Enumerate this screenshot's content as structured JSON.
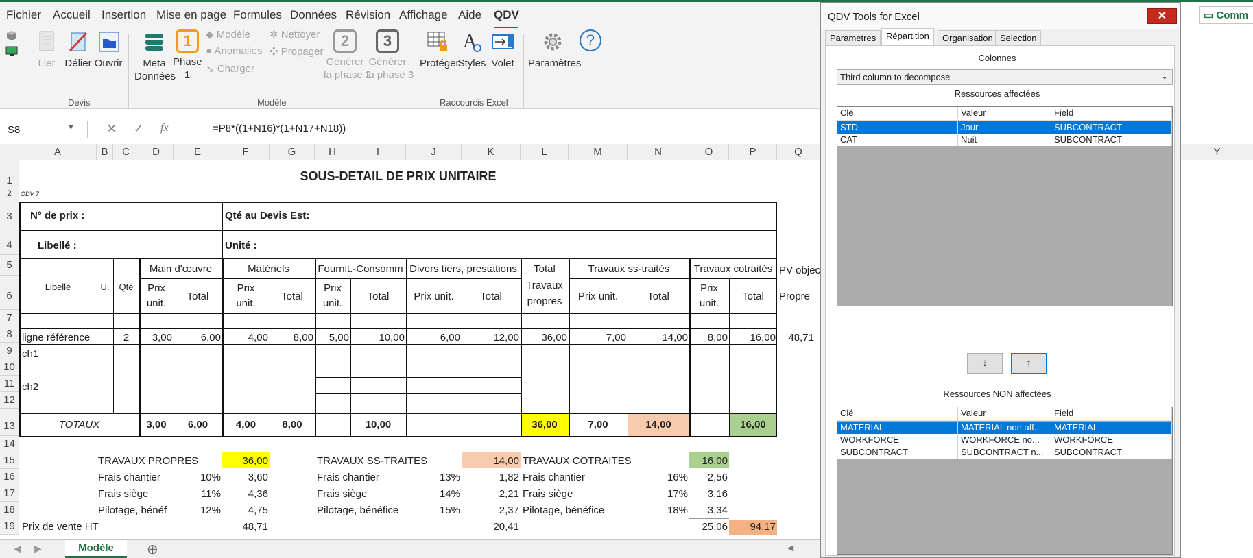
{
  "menu_tabs": [
    "Fichier",
    "Accueil",
    "Insertion",
    "Mise en page",
    "Formules",
    "Données",
    "Révision",
    "Affichage",
    "Aide",
    "QDV"
  ],
  "ribbon": {
    "devis": {
      "lier": "Lier",
      "delier": "Délier",
      "ouvrir": "Ouvrir",
      "group": "Devis"
    },
    "modele": {
      "meta_l1": "Meta",
      "meta_l2": "Données",
      "phase1_l1": "Phase",
      "phase1_l2": "1",
      "phase1_num": "1",
      "modele": "Modèle",
      "anomalies": "Anomalies",
      "charger": "Charger",
      "nettoyer": "Nettoyer",
      "propager": "Propager",
      "gen2_l1": "Générer",
      "gen2_l2": "la phase 2",
      "gen2_num": "2",
      "gen3_l1": "Générer",
      "gen3_l2": "la phase 3",
      "gen3_num": "3",
      "group": "Modèle"
    },
    "raccourcis": {
      "proteger": "Protéger",
      "styles": "Styles",
      "volet": "Volet",
      "group": "Raccourcis Excel"
    },
    "parametres": "Paramètres",
    "help_glyph": "?"
  },
  "formula_bar": {
    "cell_ref": "S8",
    "formula": "=P8*((1+N16)*(1+N17+N18))",
    "fx": "fx"
  },
  "columns": [
    "A",
    "B",
    "C",
    "D",
    "E",
    "F",
    "G",
    "H",
    "I",
    "J",
    "K",
    "L",
    "M",
    "N",
    "O",
    "P",
    "Q"
  ],
  "rows": [
    "1",
    "2",
    "3",
    "4",
    "5",
    "6",
    "7",
    "8",
    "9",
    "10",
    "11",
    "12",
    "13",
    "14",
    "15",
    "16",
    "17",
    "18",
    "19"
  ],
  "sheet": {
    "title": "SOUS-DETAIL DE PRIX UNITAIRE",
    "qdv": "QDV 7",
    "no_prix": "N° de prix :",
    "qte_devis": "Qté au Devis Est:",
    "libelle_lbl": "Libellé :",
    "unite": "Unité :",
    "hdr_libelle": "Libellé",
    "hdr_u": "U.",
    "hdr_qte": "Qté",
    "main_oeuvre": "Main d'œuvre",
    "materiels": "Matériels",
    "fournit": "Fournit.-Consomm",
    "divers": "Divers tiers, prestations",
    "total_l1": "Total",
    "total_l2": "Travaux",
    "total_l3": "propres",
    "travaux_ss": "Travaux ss-traités",
    "travaux_cot": "Travaux cotraités",
    "pv_obj": "PV objec",
    "propre": "Propre",
    "prix": "Prix",
    "unit": "unit.",
    "total": "Total",
    "prix_unit": "Prix unit.",
    "row8": {
      "lib": "ligne référence",
      "qte": "2",
      "d": "3,00",
      "e": "6,00",
      "f": "4,00",
      "g": "8,00",
      "h": "5,00",
      "i": "10,00",
      "j": "6,00",
      "k": "12,00",
      "l": "36,00",
      "m": "7,00",
      "n": "14,00",
      "o": "8,00",
      "p": "16,00",
      "q": "48,71"
    },
    "ch1": "ch1",
    "ch2": "ch2",
    "totaux": {
      "label": "TOTAUX",
      "d": "3,00",
      "e": "6,00",
      "f": "4,00",
      "g": "8,00",
      "i": "10,00",
      "l": "36,00",
      "m": "7,00",
      "n": "14,00",
      "p": "16,00"
    },
    "tp": {
      "label": "TRAVAUX PROPRES",
      "val": "36,00",
      "fc": "Frais chantier",
      "fc_pct": "10%",
      "fc_val": "3,60",
      "fs": "Frais siège",
      "fs_pct": "11%",
      "fs_val": "4,36",
      "pb": "Pilotage, bénéf",
      "pb_pct": "12%",
      "pb_val": "4,75"
    },
    "ts": {
      "label": "TRAVAUX SS-TRAITES",
      "val": "14,00",
      "fc": "Frais chantier",
      "fc_pct": "13%",
      "fc_val": "1,82",
      "fs": "Frais siège",
      "fs_pct": "14%",
      "fs_val": "2,21",
      "pb": "Pilotage, bénéfice",
      "pb_pct": "15%",
      "pb_val": "2,37"
    },
    "tc": {
      "label": "TRAVAUX COTRAITES",
      "val": "16,00",
      "fc": "Frais chantier",
      "fc_pct": "16%",
      "fc_val": "2,56",
      "fs": "Frais siège",
      "fs_pct": "17%",
      "fs_val": "3,16",
      "pb": "Pilotage, bénéfice",
      "pb_pct": "18%",
      "pb_val": "3,34"
    },
    "pv": {
      "label": "Prix de vente HT",
      "f": "48,71",
      "k": "20,41",
      "o": "25,06",
      "p": "94,17"
    }
  },
  "sheet_tab": "Modèle",
  "dialog": {
    "title": "QDV Tools for Excel",
    "close": "✕",
    "tabs": [
      "Parametres",
      "Répartition",
      "Organisation",
      "Selection"
    ],
    "colonnes": "Colonnes",
    "select_value": "Third column to decompose",
    "ressources_affectees": "Ressources affectées",
    "ressources_non": "Ressources NON affectées",
    "headers": [
      "Clé",
      "Valeur",
      "Field"
    ],
    "affectees": [
      {
        "cle": "STD",
        "valeur": "Jour",
        "field": "SUBCONTRACT"
      },
      {
        "cle": "CAT",
        "valeur": "Nuit",
        "field": "SUBCONTRACT"
      }
    ],
    "non_affectees": [
      {
        "cle": "MATERIAL",
        "valeur": "MATERIAL non aff...",
        "field": "MATERIAL"
      },
      {
        "cle": "WORKFORCE",
        "valeur": "WORKFORCE no...",
        "field": "WORKFORCE"
      },
      {
        "cle": "SUBCONTRACT",
        "valeur": "SUBCONTRACT n...",
        "field": "SUBCONTRACT"
      }
    ],
    "down": "↓",
    "up": "↑"
  },
  "right": {
    "comments": "Comm",
    "col_y": "Y"
  },
  "colors": {
    "excel_green": "#217346",
    "yellow": "#ffff00",
    "salmon": "#f8cbad",
    "green_fill": "#a9d08e",
    "orange": "#f4b183",
    "select_blue": "#0078d7",
    "close_red": "#c42b1c"
  }
}
